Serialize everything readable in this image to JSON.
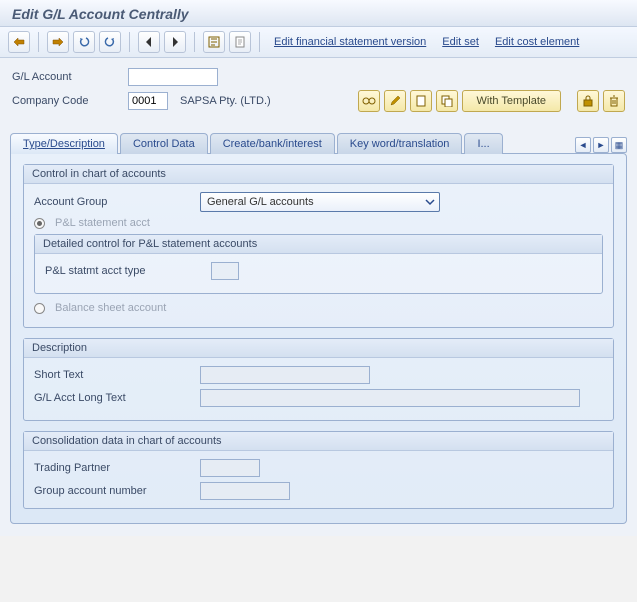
{
  "title": "Edit G/L Account Centrally",
  "toolbar": {
    "links": {
      "fin_stmt": "Edit financial statement version",
      "edit_set": "Edit set",
      "edit_cost": "Edit cost element"
    }
  },
  "header": {
    "gl_account_label": "G/L Account",
    "gl_account_value": "",
    "company_code_label": "Company Code",
    "company_code_value": "0001",
    "company_name": "SAPSA Pty. (LTD.)",
    "template_btn": "With Template"
  },
  "tabs": {
    "t1": "Type/Description",
    "t2": "Control Data",
    "t3": "Create/bank/interest",
    "t4": "Key word/translation",
    "t5": "I..."
  },
  "group_control": {
    "title": "Control in chart of accounts",
    "account_group_label": "Account Group",
    "account_group_value": "General G/L accounts",
    "pl_radio": "P&L statement acct",
    "detailed_title": "Detailed control for P&L statement accounts",
    "pl_type_label": "P&L statmt acct type",
    "balance_radio": "Balance sheet account"
  },
  "group_desc": {
    "title": "Description",
    "short_label": "Short Text",
    "long_label": "G/L Acct Long Text"
  },
  "group_consol": {
    "title": "Consolidation data in chart of accounts",
    "trading_label": "Trading Partner",
    "groupacct_label": "Group account number"
  }
}
